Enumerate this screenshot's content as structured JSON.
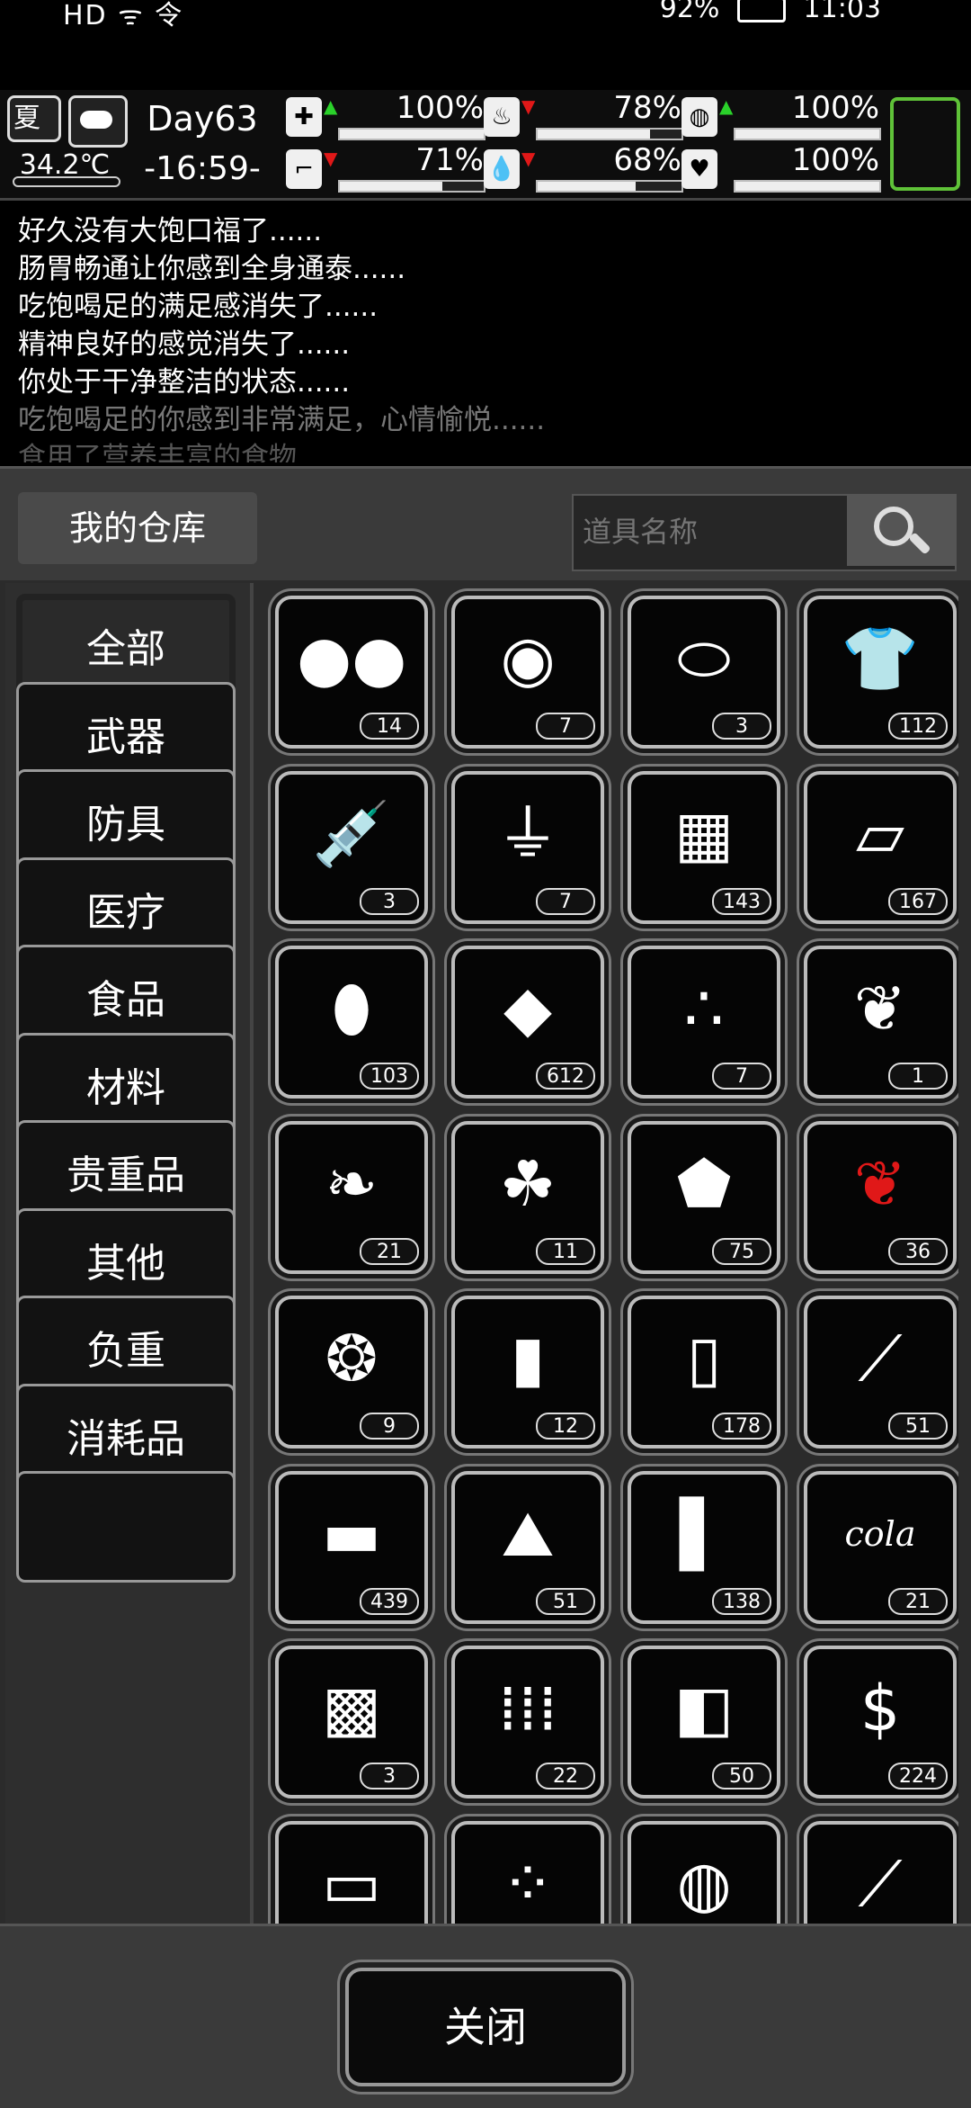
{
  "system": {
    "left": "HD ᯤ 令",
    "battery": "92%",
    "time": "11:03"
  },
  "hud": {
    "season": "夏",
    "weather_icon": "cloud-icon",
    "temperature": "34.2℃",
    "day": "Day63",
    "clock": "-16:59-",
    "stats": [
      {
        "name": "health",
        "icon": "medkit-icon",
        "trend": "up",
        "value": "100%",
        "level": 100
      },
      {
        "name": "hunger",
        "icon": "stomach-icon",
        "trend": "down",
        "value": "78%",
        "level": 78
      },
      {
        "name": "immunity",
        "icon": "shield-icon",
        "trend": "up",
        "value": "100%",
        "level": 100
      },
      {
        "name": "stamina",
        "icon": "boot-icon",
        "trend": "down",
        "value": "71%",
        "level": 71
      },
      {
        "name": "thirst",
        "icon": "water-drop-icon",
        "trend": "down",
        "value": "68%",
        "level": 68
      },
      {
        "name": "mood",
        "icon": "heart-icon",
        "trend": "none",
        "value": "100%",
        "level": 100
      }
    ]
  },
  "log": [
    "好久没有大饱口福了......",
    "肠胃畅通让你感到全身通泰......",
    "吃饱喝足的满足感消失了......",
    "精神良好的感觉消失了......",
    "你处于干净整洁的状态......",
    "吃饱喝足的你感到非常满足，心情愉悦......",
    "食用了营养丰富的食物......"
  ],
  "warehouse": {
    "title": "我的仓库",
    "search_placeholder": "道具名称",
    "categories": [
      "全部",
      "武器",
      "防具",
      "医疗",
      "食品",
      "材料",
      "贵重品",
      "其他",
      "负重",
      "消耗品",
      ""
    ],
    "items": [
      {
        "icon": "potato-pair-icon",
        "glyph": "●●",
        "count": "14"
      },
      {
        "icon": "lemon-bag-icon",
        "glyph": "◉",
        "count": "7"
      },
      {
        "icon": "pills-icon",
        "glyph": "⬭",
        "count": "3"
      },
      {
        "icon": "ragged-shirt-icon",
        "glyph": "👕",
        "count": "112"
      },
      {
        "icon": "syringe-icon",
        "glyph": "💉",
        "count": "3"
      },
      {
        "icon": "tube-paste-icon",
        "glyph": "⏚",
        "count": "7"
      },
      {
        "icon": "bricks-icon",
        "glyph": "▦",
        "count": "143"
      },
      {
        "icon": "cloth-pieces-icon",
        "glyph": "▱",
        "count": "167"
      },
      {
        "icon": "potato-icon",
        "glyph": "⬮",
        "count": "103"
      },
      {
        "icon": "meat-chunk-icon",
        "glyph": "◆",
        "count": "612"
      },
      {
        "icon": "chestnuts-icon",
        "glyph": "∴",
        "count": "7"
      },
      {
        "icon": "fern-icon",
        "glyph": "❦",
        "count": "1"
      },
      {
        "icon": "mint-leaves-icon",
        "glyph": "❧",
        "count": "21"
      },
      {
        "icon": "herb-sprig-icon",
        "glyph": "☘",
        "count": "11"
      },
      {
        "icon": "rock-chunk-icon",
        "glyph": "⬟",
        "count": "75"
      },
      {
        "icon": "red-herb-icon",
        "glyph": "❦",
        "count": "36"
      },
      {
        "icon": "ginger-icon",
        "glyph": "❂",
        "count": "9"
      },
      {
        "icon": "water-bottle-icon",
        "glyph": "▮",
        "count": "12"
      },
      {
        "icon": "sack-icon",
        "glyph": "▯",
        "count": "178"
      },
      {
        "icon": "carrots-icon",
        "glyph": "⟋",
        "count": "51"
      },
      {
        "icon": "metal-bar-icon",
        "glyph": "▬",
        "count": "439"
      },
      {
        "icon": "soil-seedling-icon",
        "glyph": "⛰",
        "count": "51"
      },
      {
        "icon": "pipe-parts-icon",
        "glyph": "▌",
        "count": "138"
      },
      {
        "icon": "cola-cup-icon",
        "glyph": "cola",
        "count": "21"
      },
      {
        "icon": "fur-pelt-icon",
        "glyph": "▩",
        "count": "3"
      },
      {
        "icon": "bullets-icon",
        "glyph": "⁞⁞⁞",
        "count": "22"
      },
      {
        "icon": "bread-bag-icon",
        "glyph": "◧",
        "count": "50"
      },
      {
        "icon": "cash-stack-icon",
        "glyph": "$",
        "count": "224"
      },
      {
        "icon": "towel-icon",
        "glyph": "▭",
        "count": ""
      },
      {
        "icon": "beans-icon",
        "glyph": "⁘",
        "count": ""
      },
      {
        "icon": "sieve-icon",
        "glyph": "◍",
        "count": ""
      },
      {
        "icon": "baguette-icon",
        "glyph": "⟋",
        "count": ""
      }
    ],
    "close_label": "关闭"
  }
}
